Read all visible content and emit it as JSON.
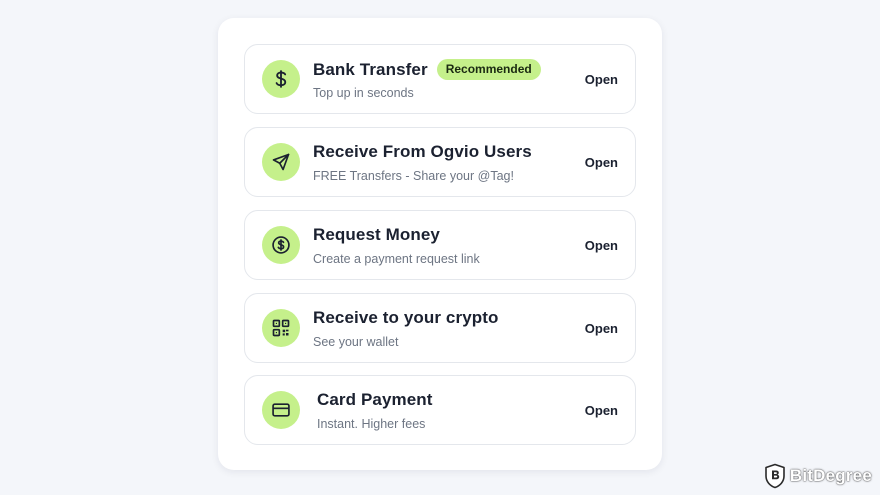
{
  "colors": {
    "accent": "#c5f08b",
    "text": "#1b2130",
    "muted": "#6d7583",
    "border": "#e4e7ec"
  },
  "options": [
    {
      "icon": "dollar-icon",
      "title": "Bank Transfer",
      "badge": "Recommended",
      "subtitle": "Top up in seconds",
      "action": "Open"
    },
    {
      "icon": "send-icon",
      "title": "Receive From Ogvio Users",
      "subtitle": "FREE Transfers - Share your @Tag!",
      "action": "Open"
    },
    {
      "icon": "dollar-circle-icon",
      "title": "Request Money",
      "subtitle": "Create a payment request link",
      "action": "Open"
    },
    {
      "icon": "qr-code-icon",
      "title": "Receive to your crypto",
      "subtitle": "See your wallet",
      "action": "Open"
    },
    {
      "icon": "credit-card-icon",
      "title": "Card Payment",
      "subtitle": "Instant. Higher fees",
      "action": "Open"
    }
  ],
  "watermark": {
    "icon": "bitdegree-shield-icon",
    "name": "BitDegree"
  }
}
